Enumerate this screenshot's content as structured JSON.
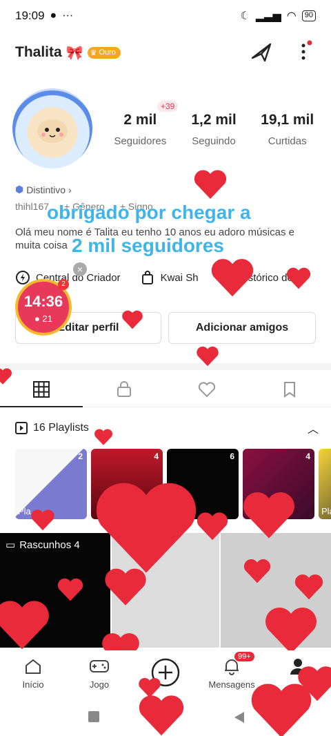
{
  "status_bar": {
    "time": "19:09",
    "battery": "90"
  },
  "header": {
    "username": "Thalita",
    "badge": "Ouro"
  },
  "stats": {
    "followers_value": "2 mil",
    "followers_label": "Seguidores",
    "followers_new": "+39",
    "following_value": "1,2 mil",
    "following_label": "Seguindo",
    "likes_value": "19,1 mil",
    "likes_label": "Curtidas"
  },
  "profile": {
    "distintivo": "Distintivo",
    "id_text": "thihl167",
    "gender_label": "+ Gênero",
    "sign_label": "+ Signo",
    "bio": "Olá meu nome é Talita eu tenho 10 anos eu adoro músicas e muita coisa"
  },
  "overlay": {
    "line1": "obrigado por chegar a",
    "line2": "2  mil seguidores"
  },
  "tools": {
    "creator_center": "Central do Criador",
    "kwai_shop": "Kwai Sh",
    "history": "Histórico de"
  },
  "timer": {
    "time": "14:36",
    "coins": "21",
    "notif": "2"
  },
  "buttons": {
    "edit_profile": "Editar perfil",
    "add_friends": "Adicionar amigos"
  },
  "playlists": {
    "title": "16 Playlists",
    "items": [
      {
        "count": "2",
        "name": "Pla"
      },
      {
        "count": "4",
        "name": ""
      },
      {
        "count": "6",
        "name": ""
      },
      {
        "count": "4",
        "name": ""
      },
      {
        "count": "",
        "name": "Pla"
      }
    ]
  },
  "drafts": {
    "label": "Rascunhos 4"
  },
  "bottom_nav": {
    "home": "Início",
    "game": "Jogo",
    "messages": "Mensagens",
    "messages_badge": "99+"
  },
  "colors": {
    "accent_red": "#e82a3a",
    "overlay_blue": "#3fb4e8",
    "gold": "#f5a623"
  }
}
